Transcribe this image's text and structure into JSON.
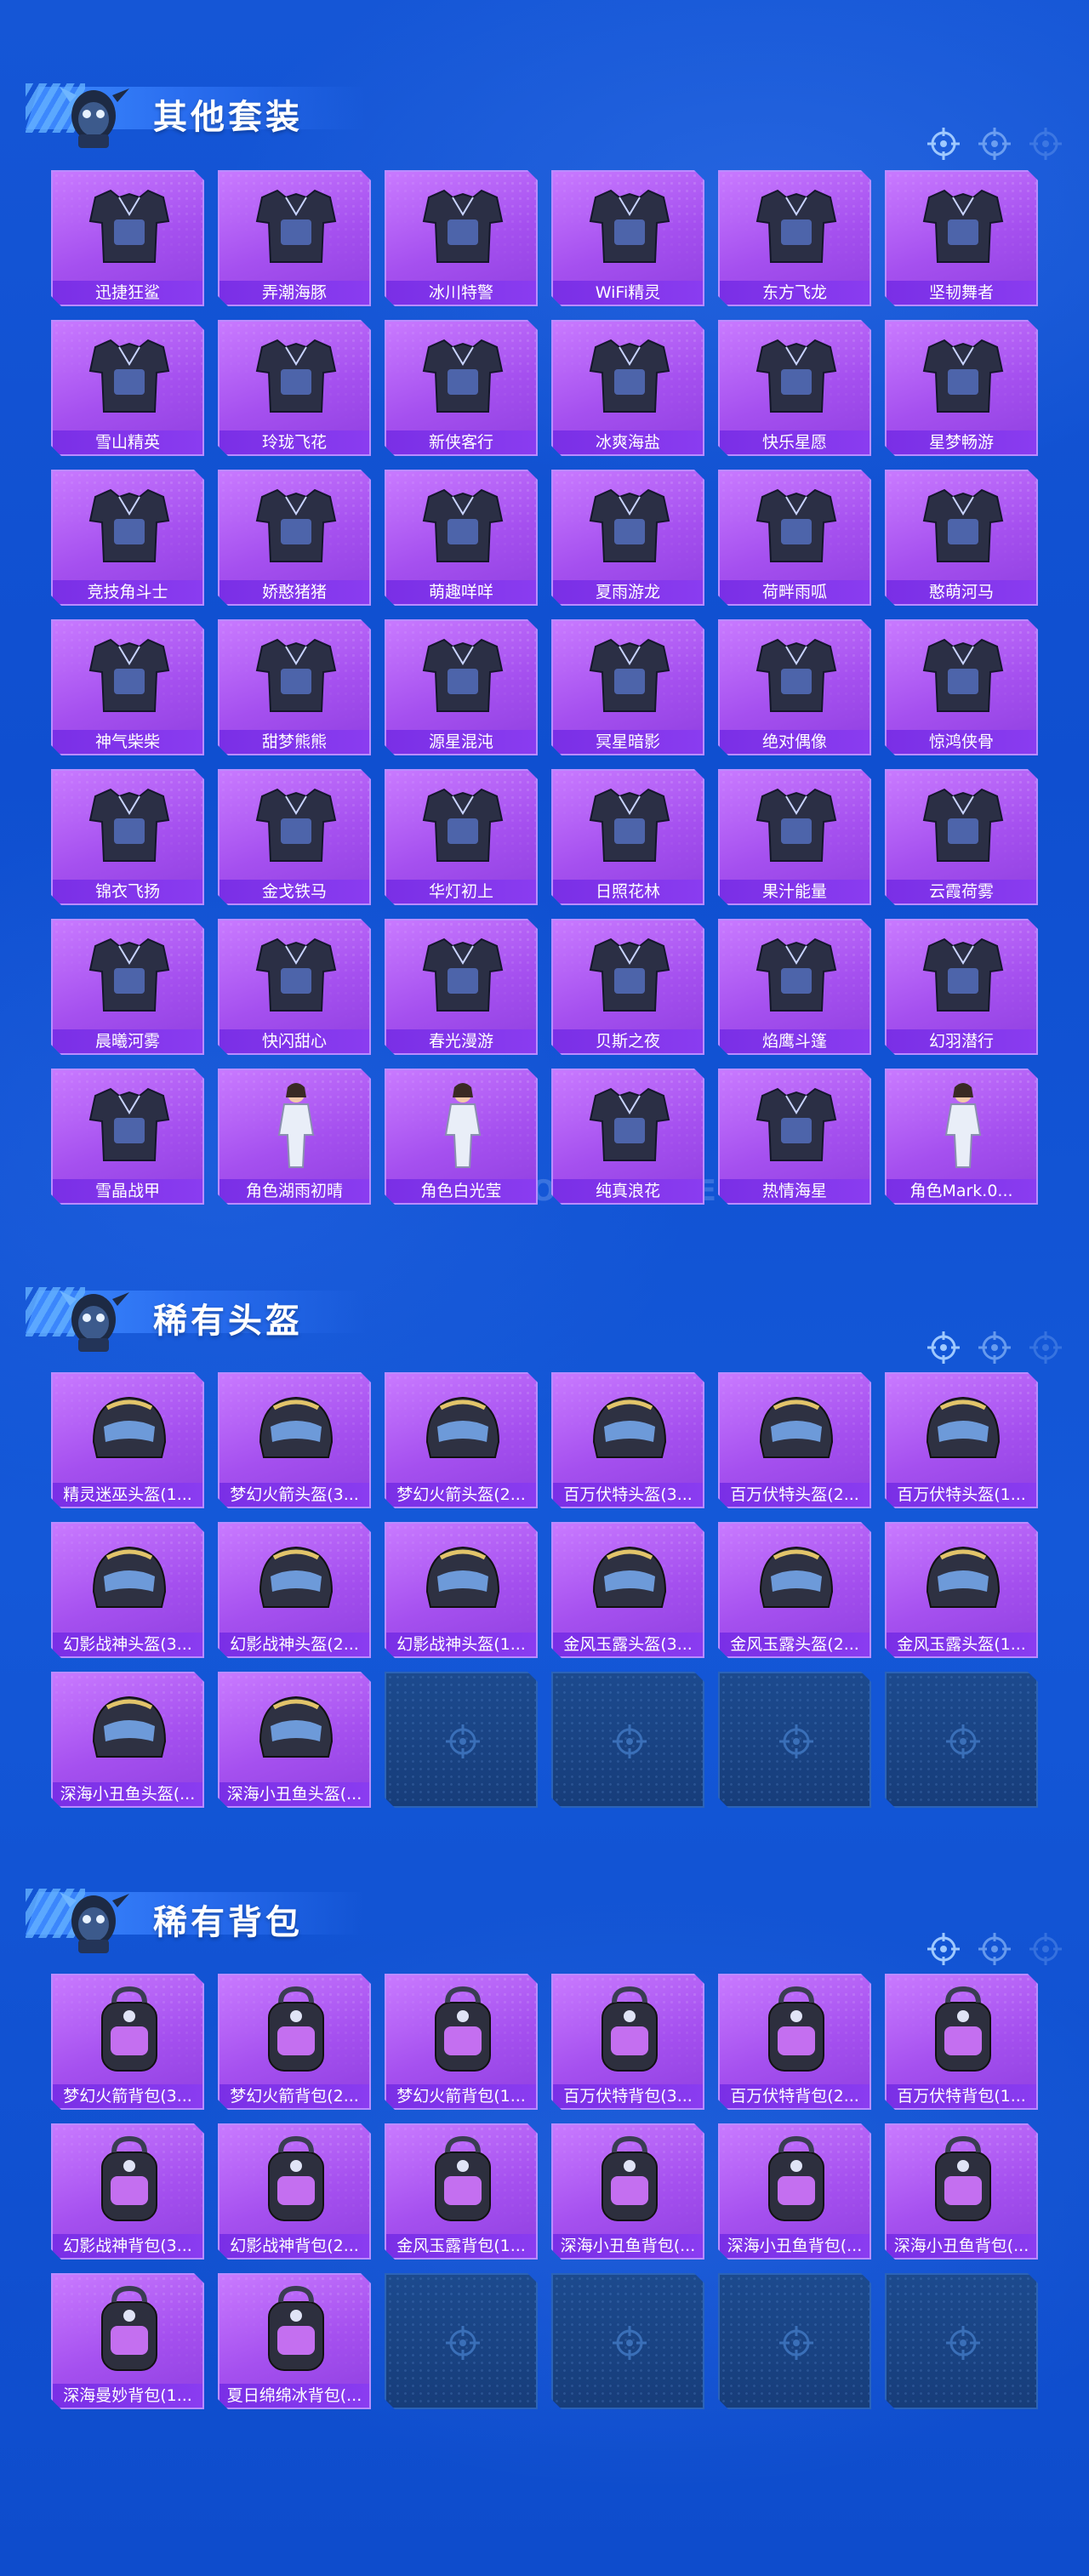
{
  "watermark": "GAME FOR PEACE",
  "accent_colors": {
    "card": "#a550ef",
    "label_bar": "#7a2fe6",
    "empty_slot": "#1c4a8e",
    "background": "#1556d6"
  },
  "sections": [
    {
      "title": "其他套装",
      "icon": "target-icon",
      "items": [
        {
          "name": "迅捷狂鲨",
          "art": "outfit-icon"
        },
        {
          "name": "弄潮海豚",
          "art": "outfit-icon"
        },
        {
          "name": "冰川特警",
          "art": "outfit-icon"
        },
        {
          "name": "WiFi精灵",
          "art": "outfit-icon"
        },
        {
          "name": "东方飞龙",
          "art": "outfit-icon"
        },
        {
          "name": "坚韧舞者",
          "art": "outfit-icon"
        },
        {
          "name": "雪山精英",
          "art": "outfit-icon"
        },
        {
          "name": "玲珑飞花",
          "art": "outfit-icon"
        },
        {
          "name": "新侠客行",
          "art": "outfit-icon"
        },
        {
          "name": "冰爽海盐",
          "art": "outfit-icon"
        },
        {
          "name": "快乐星愿",
          "art": "outfit-icon"
        },
        {
          "name": "星梦畅游",
          "art": "outfit-icon"
        },
        {
          "name": "竞技角斗士",
          "art": "outfit-icon"
        },
        {
          "name": "娇憨猪猪",
          "art": "outfit-icon"
        },
        {
          "name": "萌趣咩咩",
          "art": "outfit-icon"
        },
        {
          "name": "夏雨游龙",
          "art": "outfit-icon"
        },
        {
          "name": "荷畔雨呱",
          "art": "outfit-icon"
        },
        {
          "name": "憨萌河马",
          "art": "outfit-icon"
        },
        {
          "name": "神气柴柴",
          "art": "outfit-icon"
        },
        {
          "name": "甜梦熊熊",
          "art": "outfit-icon"
        },
        {
          "name": "源星混沌",
          "art": "outfit-icon"
        },
        {
          "name": "冥星暗影",
          "art": "outfit-icon"
        },
        {
          "name": "绝对偶像",
          "art": "outfit-icon"
        },
        {
          "name": "惊鸿侠骨",
          "art": "outfit-icon"
        },
        {
          "name": "锦衣飞扬",
          "art": "outfit-icon"
        },
        {
          "name": "金戈铁马",
          "art": "outfit-icon"
        },
        {
          "name": "华灯初上",
          "art": "outfit-icon"
        },
        {
          "name": "日照花林",
          "art": "outfit-icon"
        },
        {
          "name": "果汁能量",
          "art": "outfit-icon"
        },
        {
          "name": "云霞荷雾",
          "art": "outfit-icon"
        },
        {
          "name": "晨曦河雾",
          "art": "outfit-icon"
        },
        {
          "name": "快闪甜心",
          "art": "outfit-icon"
        },
        {
          "name": "春光漫游",
          "art": "outfit-icon"
        },
        {
          "name": "贝斯之夜",
          "art": "outfit-icon"
        },
        {
          "name": "焰鹰斗篷",
          "art": "outfit-icon"
        },
        {
          "name": "幻羽潜行",
          "art": "outfit-icon"
        },
        {
          "name": "雪晶战甲",
          "art": "outfit-icon"
        },
        {
          "name": "角色湖雨初晴",
          "art": "character-icon"
        },
        {
          "name": "角色白光莹",
          "art": "character-icon"
        },
        {
          "name": "纯真浪花",
          "art": "outfit-icon"
        },
        {
          "name": "热情海星",
          "art": "outfit-icon"
        },
        {
          "name": "角色Mark.0...",
          "art": "character-icon"
        }
      ],
      "empty_slots": 0
    },
    {
      "title": "稀有头盔",
      "icon": "target-icon",
      "items": [
        {
          "name": "精灵迷巫头盔(1...",
          "art": "helmet-icon"
        },
        {
          "name": "梦幻火箭头盔(3...",
          "art": "helmet-icon"
        },
        {
          "name": "梦幻火箭头盔(2...",
          "art": "helmet-icon"
        },
        {
          "name": "百万伏特头盔(3...",
          "art": "helmet-icon"
        },
        {
          "name": "百万伏特头盔(2...",
          "art": "helmet-icon"
        },
        {
          "name": "百万伏特头盔(1...",
          "art": "helmet-icon"
        },
        {
          "name": "幻影战神头盔(3...",
          "art": "helmet-icon"
        },
        {
          "name": "幻影战神头盔(2...",
          "art": "helmet-icon"
        },
        {
          "name": "幻影战神头盔(1...",
          "art": "helmet-icon"
        },
        {
          "name": "金风玉露头盔(3...",
          "art": "helmet-icon"
        },
        {
          "name": "金风玉露头盔(2...",
          "art": "helmet-icon"
        },
        {
          "name": "金风玉露头盔(1...",
          "art": "helmet-icon"
        },
        {
          "name": "深海小丑鱼头盔(...",
          "art": "helmet-icon"
        },
        {
          "name": "深海小丑鱼头盔(...",
          "art": "helmet-icon"
        }
      ],
      "empty_slots": 4
    },
    {
      "title": "稀有背包",
      "icon": "target-icon",
      "items": [
        {
          "name": "梦幻火箭背包(3...",
          "art": "backpack-icon"
        },
        {
          "name": "梦幻火箭背包(2...",
          "art": "backpack-icon"
        },
        {
          "name": "梦幻火箭背包(1...",
          "art": "backpack-icon"
        },
        {
          "name": "百万伏特背包(3...",
          "art": "backpack-icon"
        },
        {
          "name": "百万伏特背包(2...",
          "art": "backpack-icon"
        },
        {
          "name": "百万伏特背包(1...",
          "art": "backpack-icon"
        },
        {
          "name": "幻影战神背包(3...",
          "art": "backpack-icon"
        },
        {
          "name": "幻影战神背包(2...",
          "art": "backpack-icon"
        },
        {
          "name": "金风玉露背包(1...",
          "art": "backpack-icon"
        },
        {
          "name": "深海小丑鱼背包(...",
          "art": "backpack-icon"
        },
        {
          "name": "深海小丑鱼背包(...",
          "art": "backpack-icon"
        },
        {
          "name": "深海小丑鱼背包(...",
          "art": "backpack-icon"
        },
        {
          "name": "深海曼妙背包(1...",
          "art": "backpack-icon"
        },
        {
          "name": "夏日绵绵冰背包(...",
          "art": "backpack-icon"
        }
      ],
      "empty_slots": 4
    }
  ]
}
